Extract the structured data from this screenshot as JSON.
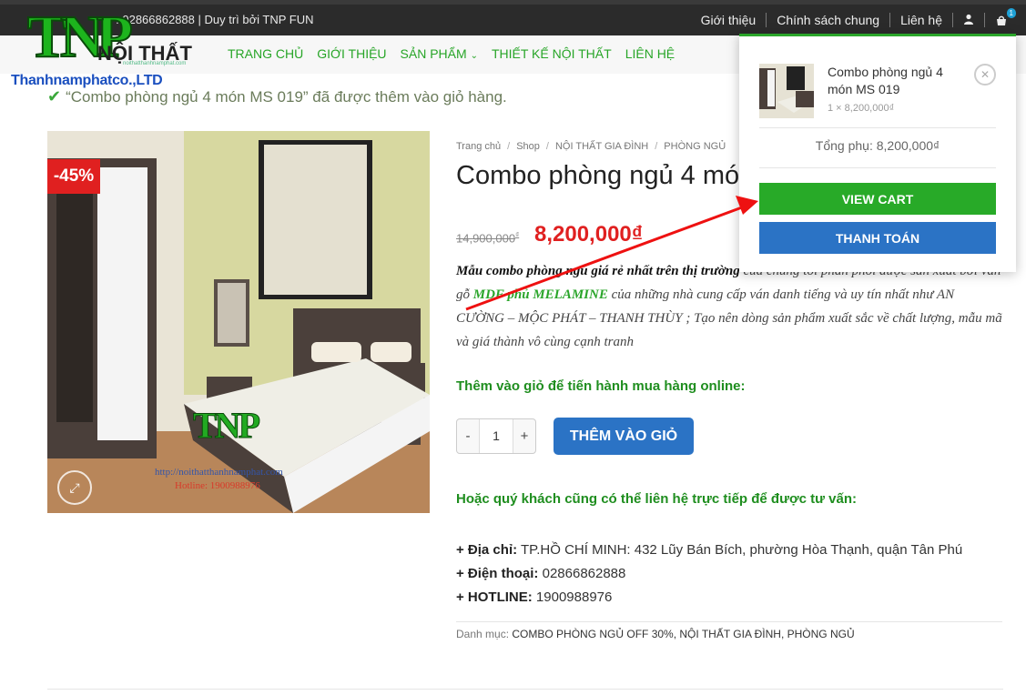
{
  "topbar": {
    "left_text": "ợ : 02866862888 | Duy trì bởi TNP FUN",
    "links": [
      "Giới thiệu",
      "Chính sách chung",
      "Liên hệ"
    ],
    "cart_count": "1"
  },
  "logo": {
    "mark": "TNP",
    "noithat": "NỘI THẤT",
    "small": "noithatthanhnamphat.com",
    "company": "Thanhnamphatco.,LTD"
  },
  "nav": {
    "items": [
      "TRANG CHỦ",
      "GIỚI THIỆU",
      "SẢN PHẨM",
      "THIẾT KẾ NỘI THẤT",
      "LIÊN HỆ"
    ]
  },
  "notice": {
    "text": "“Combo phòng ngủ 4 món MS 019” đã được thêm vào giỏ hàng."
  },
  "product": {
    "sale_badge": "-45%",
    "breadcrumb": [
      "Trang chủ",
      "Shop",
      "NỘI THẤT GIA ĐÌNH",
      "PHÒNG NGỦ"
    ],
    "title": "Combo phòng ngủ 4 món",
    "old_price": "14,900,000",
    "old_currency": "₫",
    "new_price": "8,200,000₫",
    "desc_p1_bold": "Mẫu combo phòng ngủ giá rẻ nhất trên thị trường",
    "desc_p1_rest": " của chúng tôi phân phối được sản xuất bởi ván gỗ ",
    "desc_highlight": "MDF phủ MELAMINE",
    "desc_p2": " của những nhà cung cấp ván danh tiếng và uy tín nhất như AN CƯỜNG – MỘC PHÁT – THANH THÙY ; Tạo nên dòng sản phẩm xuất sắc về chất lượng, mẫu mã và giá thành vô cùng cạnh tranh",
    "cta_label": "Thêm vào giỏ để tiến hành mua hàng online:",
    "qty_minus": "-",
    "qty_value": "1",
    "qty_plus": "+",
    "add_to_cart": "THÊM VÀO GIỎ",
    "contact_label": "Hoặc quý khách cũng có thể liên hệ trực tiếp để được tư vấn:",
    "address_label": "+ Địa chỉ:",
    "address_value": " TP.HỒ CHÍ MINH: 432 Lũy Bán Bích, phường Hòa Thạnh, quận Tân Phú",
    "phone_label": "+ Điện thoại:",
    "phone_value": " 02866862888",
    "hotline_label": "+ HOTLINE:",
    "hotline_value": " 1900988976",
    "cat_label": "Danh mục: ",
    "categories": "COMBO PHÒNG NGỦ OFF 30%, NỘI THẤT GIA ĐÌNH, PHÒNG NGỦ",
    "watermark_logo": "TNP",
    "watermark_url": "http://noithatthanhnamphat.com",
    "watermark_hotline": "Hotline: 1900988976"
  },
  "cart_popup": {
    "item_name": "Combo phòng ngủ 4 món MS 019",
    "item_qty": "1 × 8,200,000₫",
    "subtotal": "Tổng phụ: 8,200,000₫",
    "view_cart": "VIEW CART",
    "checkout": "THANH TOÁN"
  },
  "colors": {
    "brand_green": "#2aa52a",
    "price_red": "#e02020",
    "button_blue": "#2b73c5",
    "topbar": "#2b2b2b"
  }
}
